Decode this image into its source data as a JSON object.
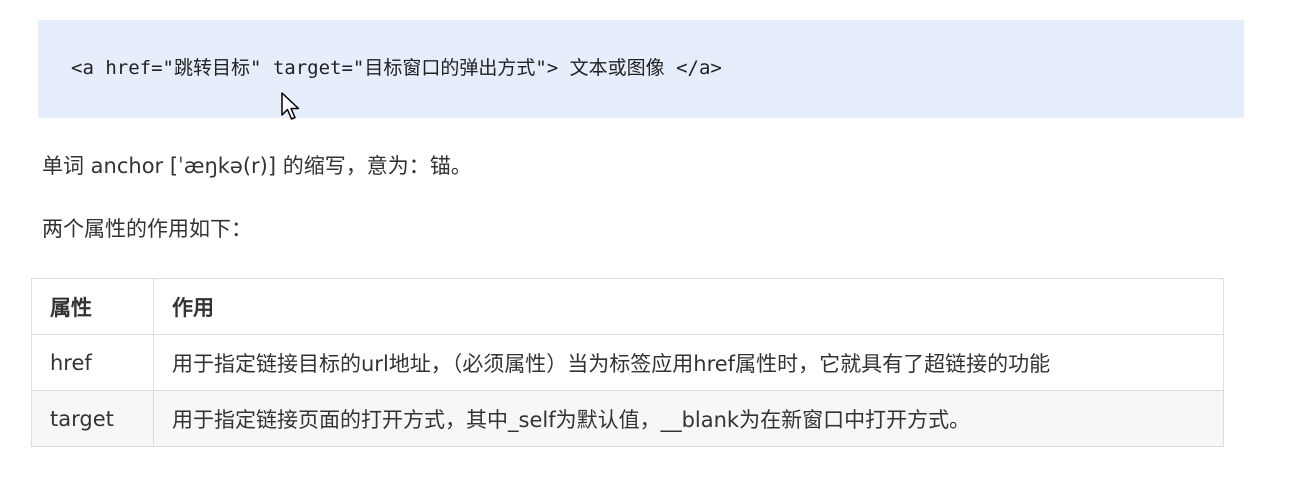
{
  "code_block": {
    "code": "<a href=\"跳转目标\" target=\"目标窗口的弹出方式\"> 文本或图像 </a>"
  },
  "paragraphs": {
    "definition": "单词 anchor [ˈæŋkə(r)] 的缩写，意为：锚。",
    "intro": "两个属性的作用如下："
  },
  "table": {
    "headers": [
      "属性",
      "作用"
    ],
    "rows": [
      {
        "attr": "href",
        "desc": "用于指定链接目标的url地址，（必须属性）当为标签应用href属性时，它就具有了超链接的功能"
      },
      {
        "attr": "target",
        "desc": "用于指定链接页面的打开方式，其中_self为默认值，__blank为在新窗口中打开方式。"
      }
    ]
  },
  "colors": {
    "code_background": "#e6eefc",
    "text": "#333333",
    "table_border": "#dddddd",
    "row_shade": "#f7f7f7"
  },
  "icons": {
    "cursor": "mouse-pointer-icon"
  }
}
